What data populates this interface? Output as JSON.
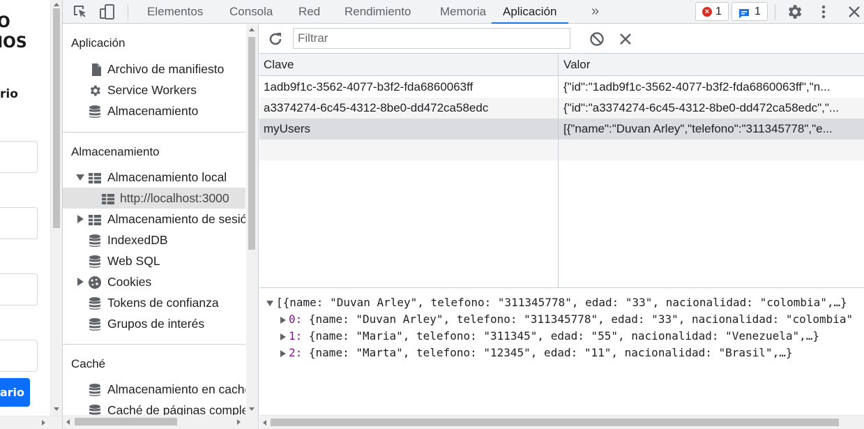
{
  "page": {
    "heading_partial": "O\nIOS",
    "label_partial": "rio",
    "button_partial": "ario"
  },
  "toolbar": {
    "tabs": [
      "Elementos",
      "Consola",
      "Red",
      "Rendimiento",
      "Memoria",
      "Aplicación"
    ],
    "more_label": "»",
    "error_count": "1",
    "message_count": "1"
  },
  "sidebar": {
    "section_app": "Aplicación",
    "app_items": [
      "Archivo de manifiesto",
      "Service Workers",
      "Almacenamiento"
    ],
    "section_storage": "Almacenamiento",
    "storage_items": [
      "Almacenamiento local",
      "http://localhost:3000",
      "Almacenamiento de sesión",
      "IndexedDB",
      "Web SQL",
      "Cookies",
      "Tokens de confianza",
      "Grupos de interés"
    ],
    "section_cache": "Caché",
    "cache_items": [
      "Almacenamiento en caché",
      "Caché de páginas completas"
    ]
  },
  "filter": {
    "placeholder": "Filtrar"
  },
  "table": {
    "columns": [
      "Clave",
      "Valor"
    ],
    "rows": [
      {
        "key": "1adb9f1c-3562-4077-b3f2-fda6860063ff",
        "value": "{\"id\":\"1adb9f1c-3562-4077-b3f2-fda6860063ff\",\"n..."
      },
      {
        "key": "a3374274-6c45-4312-8be0-dd472ca58edc",
        "value": "{\"id\":\"a3374274-6c45-4312-8be0-dd472ca58edc\",\"..."
      },
      {
        "key": "myUsers",
        "value": "[{\"name\":\"Duvan Arley\",\"telefono\":\"311345778\",\"e..."
      }
    ]
  },
  "preview": {
    "root": "[{name: \"Duvan Arley\", telefono: \"311345778\", edad: \"33\", nacionalidad: \"colombia\",…}",
    "items": [
      {
        "index": "0:",
        "text": "{name: \"Duvan Arley\", telefono: \"311345778\", edad: \"33\", nacionalidad: \"colombia\""
      },
      {
        "index": "1:",
        "text": "{name: \"Maria\", telefono: \"311345\", edad: \"55\", nacionalidad: \"Venezuela\",…}"
      },
      {
        "index": "2:",
        "text": "{name: \"Marta\", telefono: \"12345\", edad: \"11\", nacionalidad: \"Brasil\",…}"
      }
    ]
  },
  "colors": {
    "accent": "#1a73e8",
    "error": "#d93025",
    "info": "#1a73e8",
    "page_button": "#0d6efd"
  }
}
